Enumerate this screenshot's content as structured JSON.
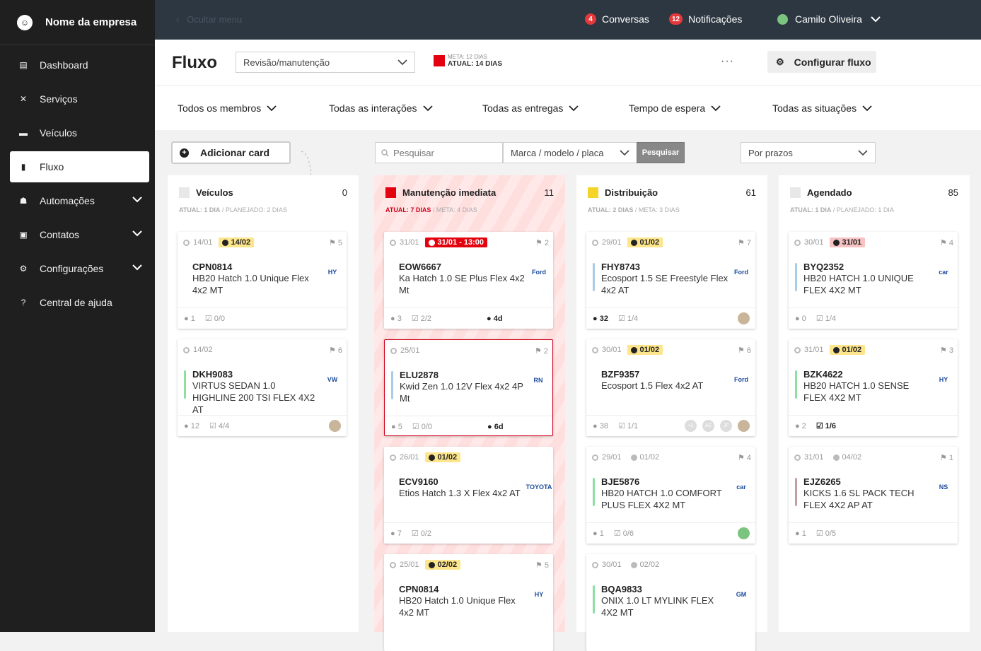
{
  "sidebar": {
    "company": "Nome da empresa",
    "items": [
      {
        "label": "Dashboard",
        "icon": "chart-icon"
      },
      {
        "label": "Serviços",
        "icon": "tools-icon"
      },
      {
        "label": "Veículos",
        "icon": "car-icon"
      },
      {
        "label": "Fluxo",
        "icon": "flow-icon",
        "active": true
      },
      {
        "label": "Automações",
        "icon": "robot-icon",
        "expandable": true
      },
      {
        "label": "Contatos",
        "icon": "contact-icon",
        "expandable": true
      },
      {
        "label": "Configurações",
        "icon": "gear-icon",
        "expandable": true
      },
      {
        "label": "Central de ajuda",
        "icon": "help-icon"
      }
    ]
  },
  "topbar": {
    "hide_menu": "Ocultar menu",
    "conversations": {
      "count": "4",
      "label": "Conversas"
    },
    "notifications": {
      "count": "12",
      "label": "Notificações"
    },
    "user": "Camilo Oliveira"
  },
  "header": {
    "title": "Fluxo",
    "flow_select": "Revisão/manutenção",
    "meta_goal": "META: 12 DIAS",
    "meta_current": "ATUAL: 14 DIAS",
    "more": "···",
    "configure": "Configurar fluxo"
  },
  "filters": [
    "Todos os membros",
    "Todas as interações",
    "Todas as entregas",
    "Tempo de espera",
    "Todas as situações"
  ],
  "toolbar": {
    "add_card": "Adicionar card",
    "search_placeholder": "Pesquisar",
    "search_field": "Marca / modelo / placa",
    "search_button": "Pesquisar",
    "sort": "Por prazos"
  },
  "columns": [
    {
      "title": "Veículos",
      "count": "0",
      "status": "ATUAL: 1 DIA",
      "planned": " / PLANEJADO: 2 DIAS",
      "color": "#e8e8e8",
      "cards": [
        {
          "date": "14/01",
          "due": "14/02",
          "due_style": "y",
          "stage": "5",
          "plate": "CPN0814",
          "model": "HB20 Hatch 1.0 Unique Flex 4x2 MT",
          "brand": "HY",
          "bar": "",
          "comments": "1",
          "tasks": "0/0",
          "bold_tasks": false,
          "late": "",
          "avatars": []
        },
        {
          "date": "14/02",
          "due": "",
          "due_style": "",
          "stage": "6",
          "plate": "DKH9083",
          "model": "VIRTUS SEDAN 1.0 HIGHLINE 200 TSI FLEX 4X2 AT",
          "brand": "VW",
          "bar": "#8ce0a0",
          "comments": "12",
          "tasks": "4/4",
          "bold_tasks": false,
          "late": "",
          "avatars": [
            "#c9b59a"
          ]
        }
      ]
    },
    {
      "title": "Manutenção imediata",
      "count": "11",
      "status": "ATUAL: 7 DIAS",
      "planned": " / META: 4 DIAS",
      "color": "#e3000f",
      "cards": [
        {
          "date": "31/01",
          "due": "31/01 - 13:00",
          "due_style": "r",
          "stage": "2",
          "plate": "EOW6667",
          "model": "Ka Hatch 1.0 SE Plus Flex 4x2 Mt",
          "brand": "Ford",
          "bar": "",
          "comments": "3",
          "tasks": "2/2",
          "bold_tasks": false,
          "late": "4d",
          "avatars": []
        },
        {
          "date": "25/01",
          "due": "",
          "due_style": "",
          "stage": "2",
          "plate": "ELU2878",
          "model": "Kwid Zen 1.0 12V Flex 4x2 4P Mt",
          "brand": "RN",
          "bar": "#a8cde8",
          "comments": "5",
          "tasks": "0/0",
          "bold_tasks": false,
          "late": "6d",
          "avatars": [],
          "red": true
        },
        {
          "date": "26/01",
          "due": "01/02",
          "due_style": "y",
          "stage": "",
          "plate": "ECV9160",
          "model": "Etios Hatch 1.3 X Flex 4x2 AT",
          "brand": "TOYOTA",
          "bar": "",
          "comments": "7",
          "tasks": "0/2",
          "bold_tasks": false,
          "late": "",
          "avatars": []
        },
        {
          "date": "25/01",
          "due": "02/02",
          "due_style": "y",
          "stage": "5",
          "plate": "CPN0814",
          "model": "HB20 Hatch 1.0 Unique Flex 4x2 MT",
          "brand": "HY",
          "bar": "",
          "comments": "",
          "tasks": "",
          "bold_tasks": false,
          "late": "",
          "avatars": []
        }
      ]
    },
    {
      "title": "Distribuição",
      "count": "61",
      "status": "ATUAL: 2 DIAS",
      "planned": " / META: 3 DIAS",
      "color": "#f5d42a",
      "cards": [
        {
          "date": "29/01",
          "due": "01/02",
          "due_style": "y",
          "stage": "7",
          "plate": "FHY8743",
          "model": "Ecosport 1.5 SE Freestyle Flex 4x2 AT",
          "brand": "Ford",
          "bar": "#a8cde8",
          "comments": "32",
          "tasks": "1/4",
          "bold_tasks": false,
          "bold_comments": true,
          "late": "",
          "avatars": [
            "#c9b59a"
          ]
        },
        {
          "date": "30/01",
          "due": "01/02",
          "due_style": "y",
          "stage": "6",
          "plate": "BZF9357",
          "model": "Ecosport 1.5 Flex 4x2 AT",
          "brand": "Ford",
          "bar": "",
          "comments": "38",
          "tasks": "1/1",
          "bold_tasks": false,
          "late": "",
          "avatars": [
            "#ddd",
            "#ddd",
            "#ddd",
            "#c9b59a"
          ],
          "avatar_labels": [
            "+2",
            "AE",
            "JF",
            ""
          ]
        },
        {
          "date": "29/01",
          "due": "01/02",
          "due_style": "n",
          "stage": "4",
          "plate": "BJE5876",
          "model": "HB20 HATCH 1.0 COMFORT PLUS FLEX 4X2 MT",
          "brand": "car",
          "bar": "#8ce0a0",
          "comments": "1",
          "tasks": "0/6",
          "bold_tasks": false,
          "late": "",
          "avatars": [
            "#7bc47f"
          ]
        },
        {
          "date": "30/01",
          "due": "02/02",
          "due_style": "n",
          "stage": "",
          "plate": "BQA9833",
          "model": "ONIX 1.0 LT MYLINK FLEX 4X2 MT",
          "brand": "GM",
          "bar": "#8ce0a0",
          "comments": "",
          "tasks": "",
          "bold_tasks": false,
          "late": "",
          "avatars": []
        }
      ]
    },
    {
      "title": "Agendado",
      "count": "85",
      "status": "ATUAL: 1 DIA",
      "planned": " / PLANEJADO: 1 DIA",
      "color": "#e8e8e8",
      "cards": [
        {
          "date": "30/01",
          "due": "31/01",
          "due_style": "p",
          "stage": "4",
          "plate": "BYQ2352",
          "model": "HB20 HATCH 1.0 UNIQUE FLEX 4X2 MT",
          "brand": "car",
          "bar": "#a8cde8",
          "comments": "0",
          "tasks": "1/4",
          "bold_tasks": false,
          "late": "",
          "avatars": []
        },
        {
          "date": "31/01",
          "due": "01/02",
          "due_style": "y",
          "stage": "3",
          "plate": "BZK4622",
          "model": "HB20 HATCH 1.0 SENSE FLEX 4X2 MT",
          "brand": "HY",
          "bar": "#8ce0a0",
          "comments": "2",
          "tasks": "1/6",
          "bold_tasks": true,
          "late": "",
          "avatars": []
        },
        {
          "date": "31/01",
          "due": "04/02",
          "due_style": "n",
          "stage": "1",
          "plate": "EJZ6265",
          "model": "KICKS 1.6 SL PACK TECH FLEX 4X2 AP AT",
          "brand": "NS",
          "bar": "#c4a0a0",
          "comments": "1",
          "tasks": "0/5",
          "bold_tasks": false,
          "late": "",
          "avatars": []
        }
      ]
    }
  ]
}
